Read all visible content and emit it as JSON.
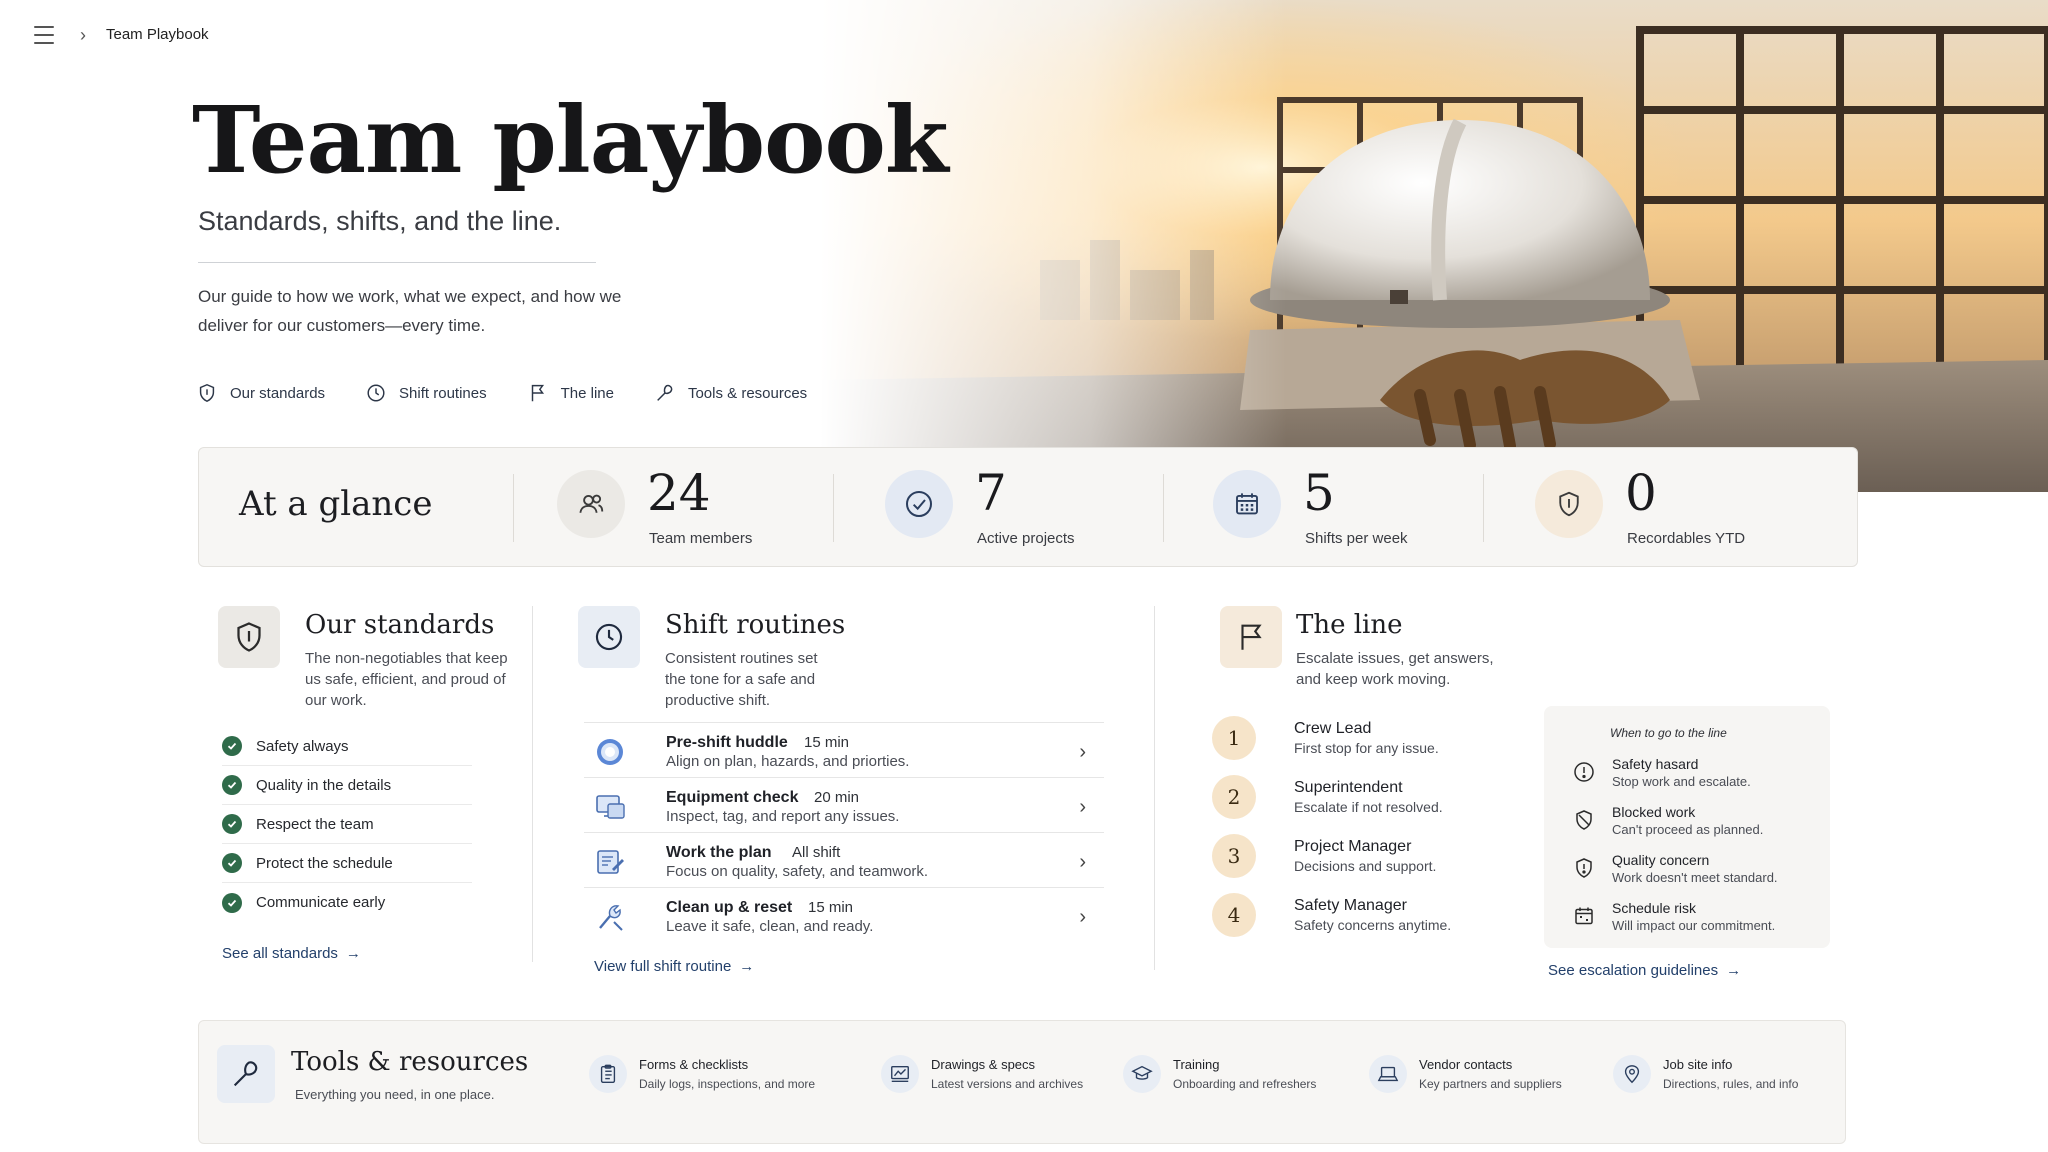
{
  "breadcrumb": {
    "title": "Team Playbook"
  },
  "hero": {
    "title": "Team playbook",
    "subtitle": "Standards, shifts, and the line.",
    "description": "Our guide to how we work, what we expect, and how we deliver for our customers—every time.",
    "nav": [
      {
        "label": "Our standards",
        "icon": "shield-icon"
      },
      {
        "label": "Shift routines",
        "icon": "clock-icon"
      },
      {
        "label": "The line",
        "icon": "flag-icon"
      },
      {
        "label": "Tools & resources",
        "icon": "wrench-icon"
      }
    ]
  },
  "glance": {
    "title": "At a glance",
    "stats": [
      {
        "value": "24",
        "label": "Team members",
        "icon": "team-icon",
        "color": "#ebe9e5"
      },
      {
        "value": "7",
        "label": "Active projects",
        "icon": "check-circle-icon",
        "color": "#e3e9f3"
      },
      {
        "value": "5",
        "label": "Shifts per week",
        "icon": "calendar-icon",
        "color": "#e3e9f3"
      },
      {
        "value": "0",
        "label": "Recordables YTD",
        "icon": "shield-icon",
        "color": "#f5eadb"
      }
    ]
  },
  "standards": {
    "title": "Our standards",
    "description": "The non-negotiables that keep us safe, efficient, and proud of our work.",
    "items": [
      "Safety always",
      "Quality in the details",
      "Respect the team",
      "Protect the schedule",
      "Communicate early"
    ],
    "link": "See all standards"
  },
  "routines": {
    "title": "Shift routines",
    "description": "Consistent routines set the tone for a safe and productive shift.",
    "items": [
      {
        "name": "Pre-shift huddle",
        "duration": "15 min",
        "desc": "Align on plan, hazards, and priorties.",
        "icon": "huddle-icon"
      },
      {
        "name": "Equipment check",
        "duration": "20 min",
        "desc": "Inspect, tag, and report any issues.",
        "icon": "monitor-icon"
      },
      {
        "name": "Work the plan",
        "duration": "All shift",
        "desc": "Focus on quality, safety, and teamwork.",
        "icon": "clipboard-edit-icon"
      },
      {
        "name": "Clean up & reset",
        "duration": "15 min",
        "desc": "Leave it safe, clean, and ready.",
        "icon": "tools-icon"
      }
    ],
    "link": "View full shift routine"
  },
  "line": {
    "title": "The line",
    "description": "Escalate issues, get answers, and keep work moving.",
    "items": [
      {
        "num": "1",
        "name": "Crew Lead",
        "desc": "First stop for any issue."
      },
      {
        "num": "2",
        "name": "Superintendent",
        "desc": "Escalate if not resolved."
      },
      {
        "num": "3",
        "name": "Project Manager",
        "desc": "Decisions and support."
      },
      {
        "num": "4",
        "name": "Safety Manager",
        "desc": "Safety concerns anytime."
      }
    ],
    "when": {
      "title": "When to go to the line",
      "items": [
        {
          "name": "Safety hasard",
          "desc": "Stop work and escalate.",
          "icon": "alert-icon"
        },
        {
          "name": "Blocked work",
          "desc": "Can't proceed as planned.",
          "icon": "shield-slash-icon"
        },
        {
          "name": "Quality concern",
          "desc": "Work doesn't meet standard.",
          "icon": "shield-alert-icon"
        },
        {
          "name": "Schedule risk",
          "desc": "Will impact our commitment.",
          "icon": "calendar-icon"
        }
      ]
    },
    "link": "See escalation guidelines"
  },
  "tools": {
    "title": "Tools & resources",
    "subtitle": "Everything you need, in one place.",
    "items": [
      {
        "name": "Forms & checklists",
        "desc": "Daily logs, inspections, and more",
        "icon": "checklist-icon"
      },
      {
        "name": "Drawings & specs",
        "desc": "Latest versions and archives",
        "icon": "drawing-icon"
      },
      {
        "name": "Training",
        "desc": "Onboarding and refreshers",
        "icon": "graduation-cap-icon"
      },
      {
        "name": "Vendor contacts",
        "desc": "Key partners and suppliers",
        "icon": "laptop-icon"
      },
      {
        "name": "Job site info",
        "desc": "Directions, rules, and info",
        "icon": "map-pin-icon"
      }
    ]
  }
}
